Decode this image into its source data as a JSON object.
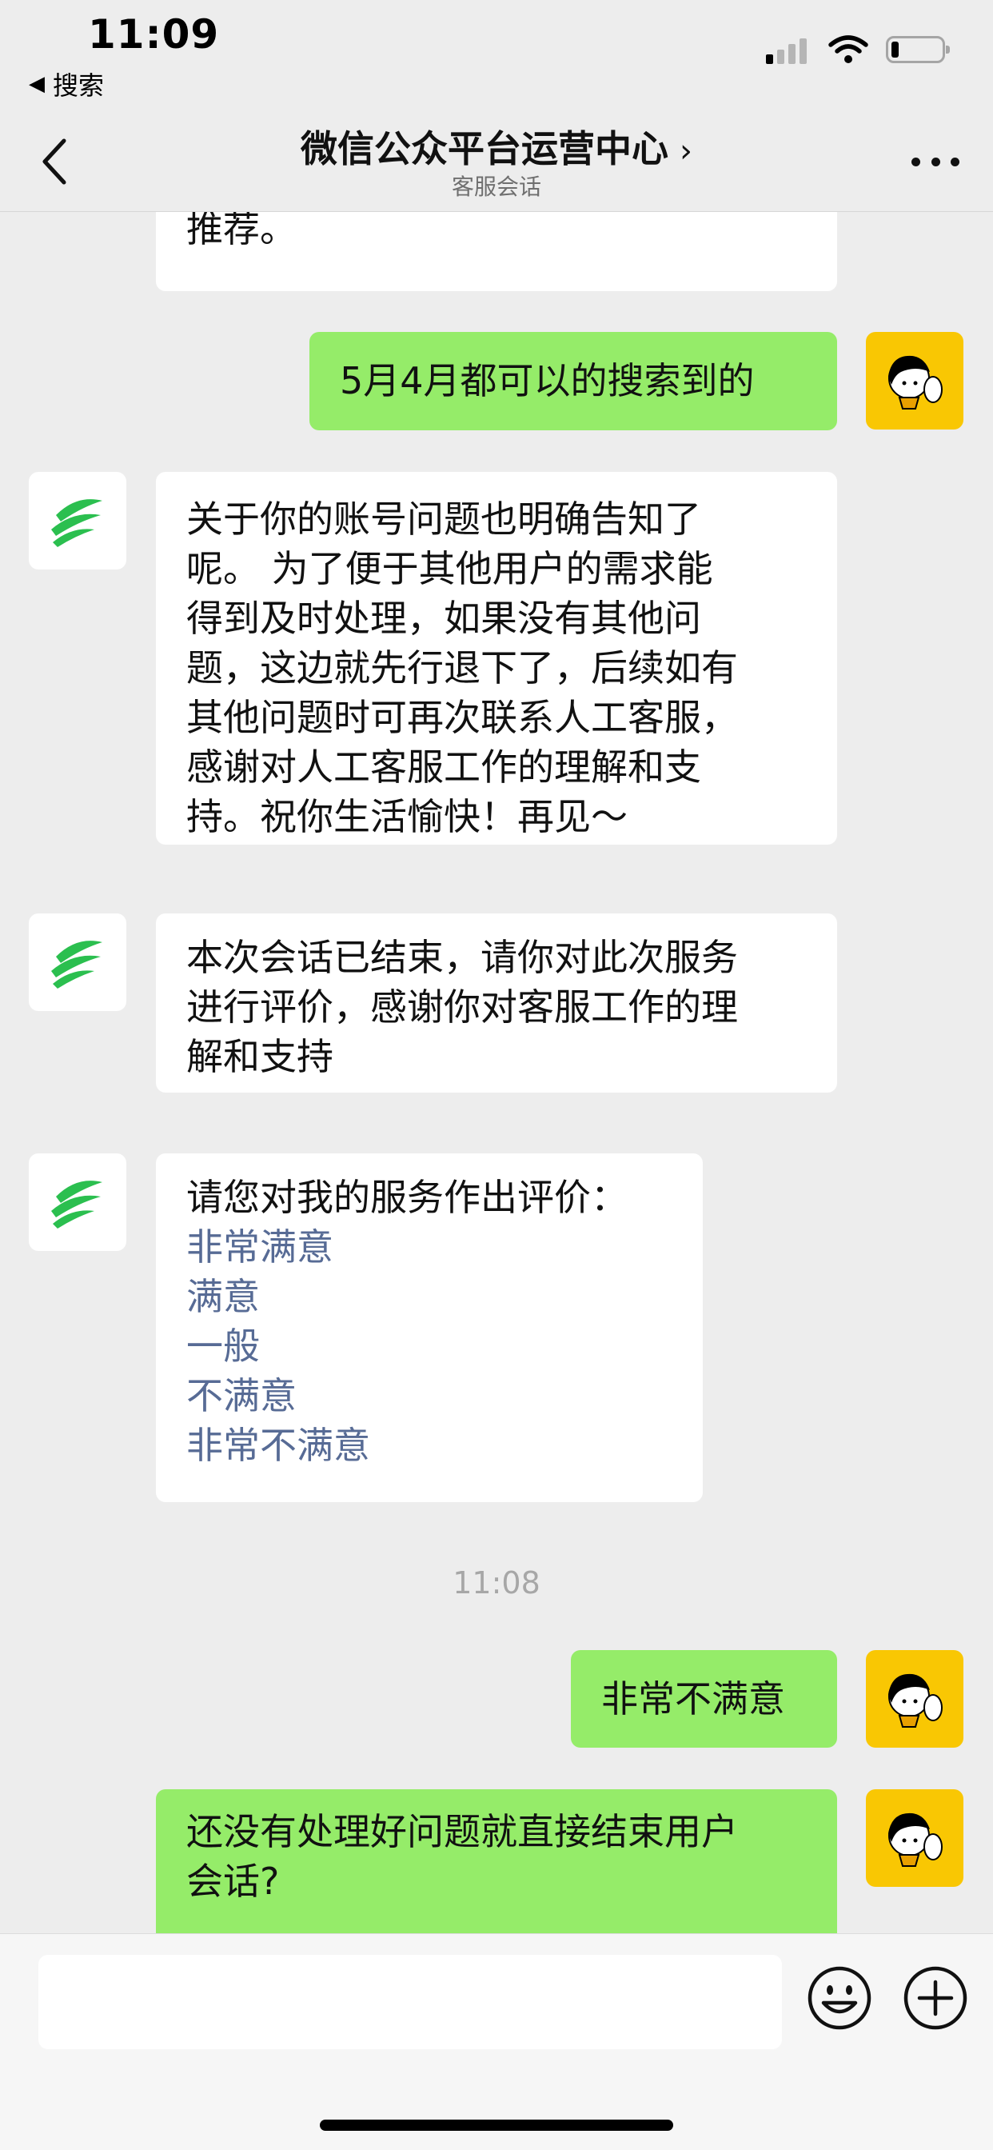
{
  "status_bar": {
    "time": "11:09",
    "back_app_label": "搜索",
    "back_app_icon": "left-triangle-icon",
    "signal_bars_on": 1,
    "signal_bars_total": 4,
    "battery_level": 0.15
  },
  "header": {
    "title": "微信公众平台运营中心",
    "subtitle": "客服会话",
    "back_icon": "chevron-left-icon",
    "chevron_icon": "chevron-right-icon",
    "more_icon": "more-dots-icon"
  },
  "messages": [
    {
      "from": "service",
      "text": "推荐。"
    },
    {
      "from": "user",
      "text": "5月4月都可以的搜索到的"
    },
    {
      "from": "service",
      "lines": [
        "关于你的账号问题也明确告知了",
        "呢。 为了便于其他用户的需求能",
        "得到及时处理，如果没有其他问",
        "题，这边就先行退下了，后续如有",
        "其他问题时可再次联系人工客服，",
        "感谢对人工客服工作的理解和支",
        "持。祝你生活愉快！再见～"
      ]
    },
    {
      "from": "service",
      "lines": [
        "本次会话已结束，请你对此次服务",
        "进行评价，感谢你对客服工作的理",
        "解和支持"
      ]
    },
    {
      "from": "service",
      "prompt": "请您对我的服务作出评价：",
      "options": [
        "非常满意",
        "满意",
        "一般",
        "不满意",
        "非常不满意"
      ]
    },
    {
      "from": "user",
      "text": "非常不满意"
    },
    {
      "from": "user",
      "lines": [
        "还没有处理好问题就直接结束用户",
        "会话?"
      ]
    }
  ],
  "time_divider": "11:08",
  "input_bar": {
    "placeholder": "",
    "emoji_icon": "smiley-icon",
    "plus_icon": "plus-circle-icon"
  },
  "colors": {
    "background": "#ededed",
    "incoming_bubble": "#ffffff",
    "outgoing_bubble": "#95ec69",
    "link": "#576b95",
    "user_avatar": "#f9c703",
    "bot_logo": "#2bbf4f"
  }
}
